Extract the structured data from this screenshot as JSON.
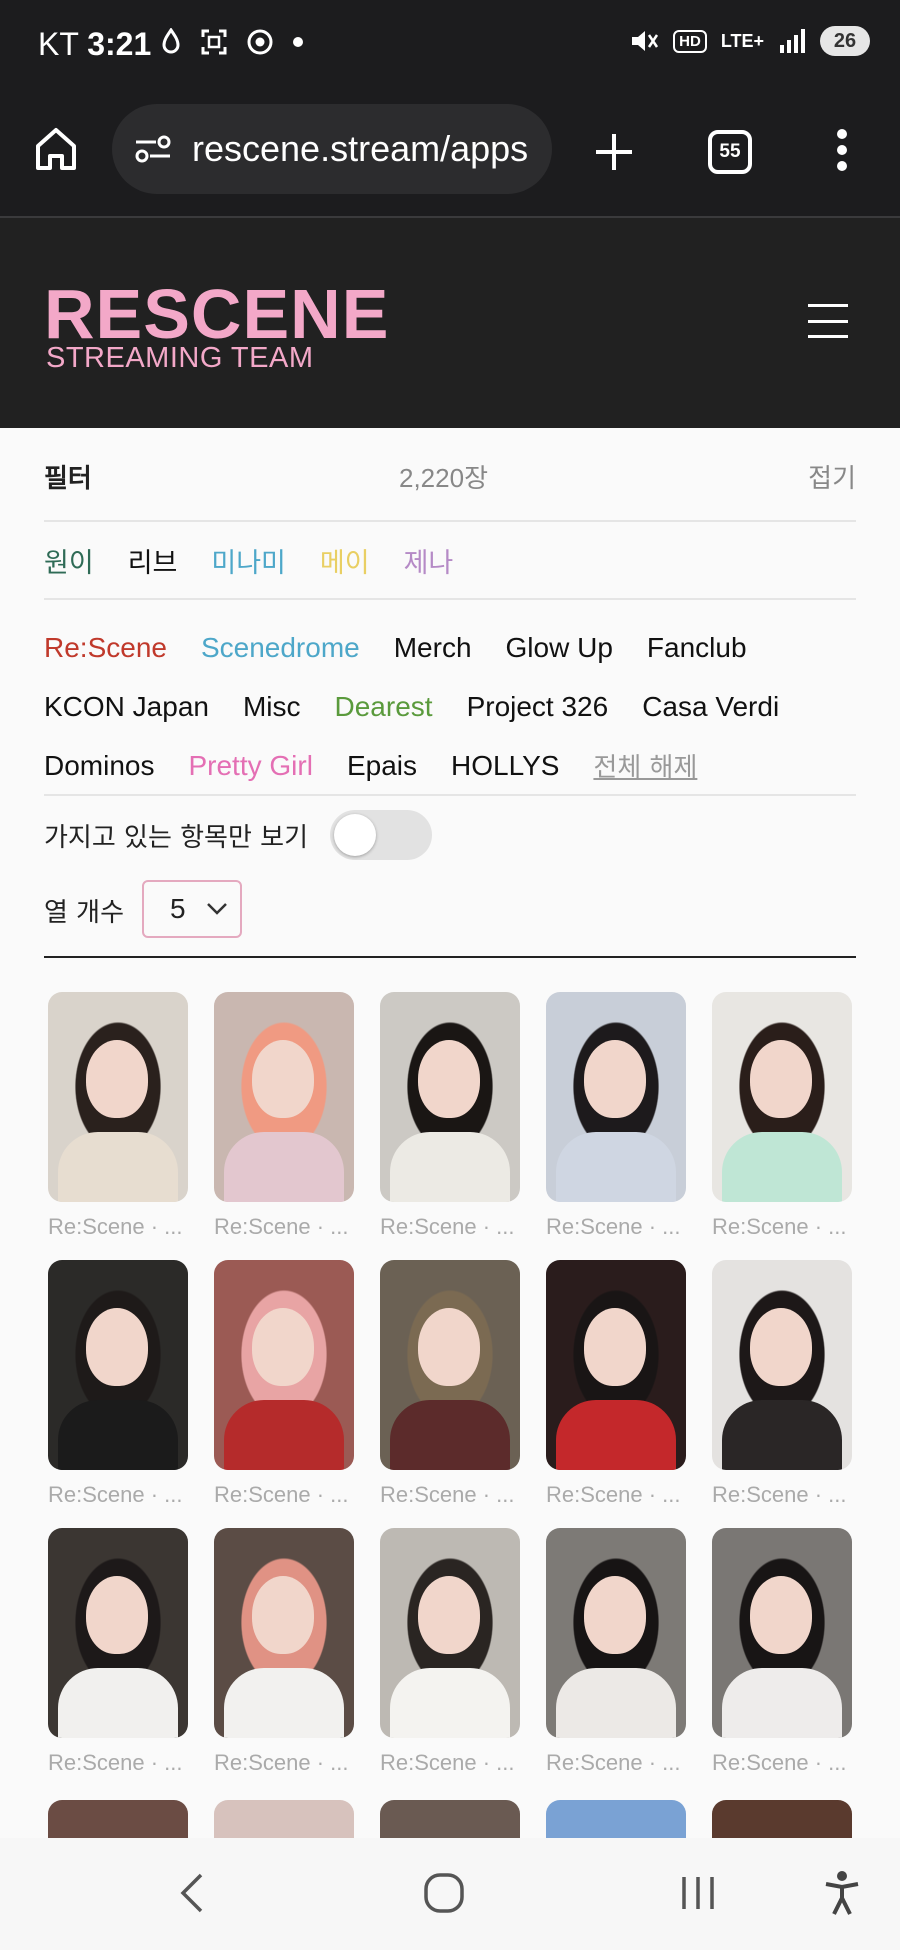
{
  "status_bar": {
    "carrier": "KT",
    "time": "3:21",
    "hd": "HD",
    "network": "LTE+",
    "battery": "26"
  },
  "browser": {
    "url": "rescene.stream/apps",
    "tab_count": "55"
  },
  "header": {
    "logo_main": "RESCENE",
    "logo_sub": "STREAMING TEAM"
  },
  "filter": {
    "title": "필터",
    "count": "2,220장",
    "fold": "접기"
  },
  "members": [
    {
      "label": "원이",
      "color": "#2f6b56"
    },
    {
      "label": "리브",
      "color": "#111111"
    },
    {
      "label": "미나미",
      "color": "#4da7c9"
    },
    {
      "label": "메이",
      "color": "#e9cf63"
    },
    {
      "label": "제나",
      "color": "#b58ac6"
    }
  ],
  "tags": {
    "row1": [
      {
        "label": "Re:Scene",
        "color": "#c0392b"
      },
      {
        "label": "Scenedrome",
        "color": "#4da7c9"
      },
      {
        "label": "Merch",
        "color": "#111111"
      },
      {
        "label": "Glow Up",
        "color": "#111111"
      },
      {
        "label": "Fanclub",
        "color": "#111111"
      }
    ],
    "row2": [
      {
        "label": "KCON Japan",
        "color": "#111111"
      },
      {
        "label": "Misc",
        "color": "#111111"
      },
      {
        "label": "Dearest",
        "color": "#5a9a3c"
      },
      {
        "label": "Project 326",
        "color": "#111111"
      },
      {
        "label": "Casa Verdi",
        "color": "#111111"
      }
    ],
    "row3": [
      {
        "label": "Dominos",
        "color": "#111111"
      },
      {
        "label": "Pretty Girl",
        "color": "#e46fb4"
      },
      {
        "label": "Epais",
        "color": "#111111"
      },
      {
        "label": "HOLLYS",
        "color": "#111111"
      }
    ],
    "clear_all": "전체 해제"
  },
  "owned_only": {
    "label": "가지고 있는 항목만 보기",
    "on": false
  },
  "columns": {
    "label": "열 개수",
    "value": "5"
  },
  "cards": [
    {
      "caption": "Re:Scene · ...",
      "hair": "#2a211d",
      "bg": "#d9d3cb",
      "top": "#e7ddd0"
    },
    {
      "caption": "Re:Scene · ...",
      "hair": "#f09a82",
      "bg": "#c9b7b0",
      "top": "#e3c7cf"
    },
    {
      "caption": "Re:Scene · ...",
      "hair": "#1a1614",
      "bg": "#ccc9c4",
      "top": "#eceae4"
    },
    {
      "caption": "Re:Scene · ...",
      "hair": "#1d1a1c",
      "bg": "#c8ced8",
      "top": "#cfd6e2"
    },
    {
      "caption": "Re:Scene · ...",
      "hair": "#2a1e1a",
      "bg": "#e8e6e2",
      "top": "#bfe6d5"
    },
    {
      "caption": "Re:Scene · ...",
      "hair": "#1e1a19",
      "bg": "#2b2a28",
      "top": "#1b1b1b"
    },
    {
      "caption": "Re:Scene · ...",
      "hair": "#e8a4a4",
      "bg": "#9b5a54",
      "top": "#b52b2b"
    },
    {
      "caption": "Re:Scene · ...",
      "hair": "#7b6a52",
      "bg": "#6b6154",
      "top": "#5c2b2b"
    },
    {
      "caption": "Re:Scene · ...",
      "hair": "#191515",
      "bg": "#2a1c1c",
      "top": "#c4282b"
    },
    {
      "caption": "Re:Scene · ...",
      "hair": "#1d1818",
      "bg": "#e4e2e0",
      "top": "#2a2626"
    },
    {
      "caption": "Re:Scene · ...",
      "hair": "#1d1919",
      "bg": "#3b3632",
      "top": "#f1f0ee"
    },
    {
      "caption": "Re:Scene · ...",
      "hair": "#e09284",
      "bg": "#5b4c45",
      "top": "#f2f1ef"
    },
    {
      "caption": "Re:Scene · ...",
      "hair": "#2a2522",
      "bg": "#bdb9b3",
      "top": "#f4f3f0"
    },
    {
      "caption": "Re:Scene · ...",
      "hair": "#171414",
      "bg": "#7d7a76",
      "top": "#ece9e6"
    },
    {
      "caption": "Re:Scene · ...",
      "hair": "#181515",
      "bg": "#7a7774",
      "top": "#eeeceb"
    }
  ],
  "partial_row": [
    "#6b4c44",
    "#d7c2bd",
    "#6a5a52",
    "#7aa2d4",
    "#5a3a2e"
  ]
}
